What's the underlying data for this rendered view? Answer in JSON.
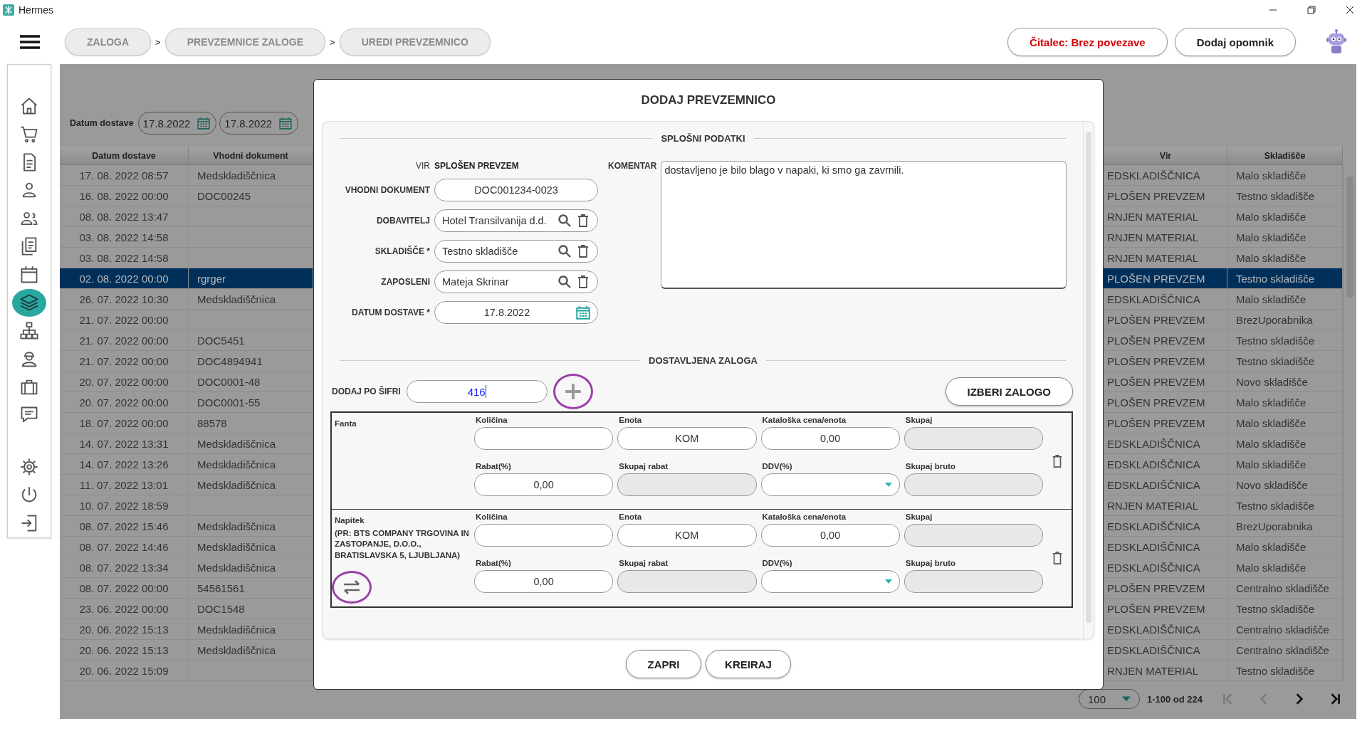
{
  "window": {
    "title": "Hermes"
  },
  "breadcrumbs": [
    {
      "label": "ZALOGA"
    },
    {
      "label": "PREVZEMNICE ZALOGE",
      "separator_before": ">"
    },
    {
      "label": "UREDI PREVZEMNICO",
      "separator_before": ">"
    }
  ],
  "header_buttons": [
    {
      "label": "Čitalec: Brez povezave",
      "kind": "warning"
    },
    {
      "label": "Dodaj opomnik",
      "kind": "normal"
    }
  ],
  "sidebar": {
    "items": [
      {
        "selected": false
      },
      {
        "selected": false
      },
      {
        "selected": false
      },
      {
        "selected": false
      },
      {
        "selected": false
      },
      {
        "selected": false
      },
      {
        "selected": false
      },
      {
        "selected": true
      },
      {
        "selected": false
      },
      {
        "selected": false
      },
      {
        "selected": false
      },
      {
        "selected": false
      }
    ],
    "bottom_items": [
      {
        "selected": false
      },
      {
        "selected": false
      },
      {
        "selected": false
      }
    ]
  },
  "filters": {
    "label": "Datum dostave",
    "date_from": "17.8.2022",
    "date_to": "17.8.2022"
  },
  "table": {
    "columns": [
      "Datum dostave",
      "Vhodni dokument",
      "Vir",
      "Skladišče"
    ],
    "rows": [
      {
        "date": "17. 08. 2022 08:57",
        "document": "Medskladiščnica",
        "source": "EDSKLADIŠČNICA",
        "warehouse": "Malo skladišče",
        "selected": false
      },
      {
        "date": "16. 08. 2022 00:00",
        "document": "DOC00245",
        "source": "PLOŠEN PREVZEM",
        "warehouse": "Testno skladišče",
        "selected": false
      },
      {
        "date": "08. 08. 2022 13:47",
        "source": "RNJEN MATERIAL",
        "warehouse": "Malo skladišče",
        "selected": false
      },
      {
        "date": "03. 08. 2022 14:58",
        "source": "RNJEN MATERIAL",
        "warehouse": "Malo skladišče",
        "selected": false
      },
      {
        "date": "03. 08. 2022 14:58",
        "source": "RNJEN MATERIAL",
        "warehouse": "Malo skladišče",
        "selected": false
      },
      {
        "date": "02. 08. 2022 00:00",
        "document": "rgrger",
        "source": "PLOŠEN PREVZEM",
        "warehouse": "Testno skladišče",
        "selected": true
      },
      {
        "date": "26. 07. 2022 10:30",
        "document": "Medskladiščnica",
        "source": "EDSKLADIŠČNICA",
        "warehouse": "Malo skladišče",
        "selected": false
      },
      {
        "date": "21. 07. 2022 00:00",
        "source": "PLOŠEN PREVZEM",
        "warehouse": "BrezUporabnika",
        "selected": false
      },
      {
        "date": "21. 07. 2022 00:00",
        "document": "DOC5451",
        "source": "PLOŠEN PREVZEM",
        "warehouse": "Testno skladišče",
        "selected": false
      },
      {
        "date": "21. 07. 2022 00:00",
        "document": "DOC4894941",
        "source": "PLOŠEN PREVZEM",
        "warehouse": "Testno skladišče",
        "selected": false
      },
      {
        "date": "20. 07. 2022 00:00",
        "document": "DOC0001-48",
        "source": "PLOŠEN PREVZEM",
        "warehouse": "Novo skladišče",
        "selected": false
      },
      {
        "date": "20. 07. 2022 00:00",
        "document": "DOC0001-55",
        "source": "PLOŠEN PREVZEM",
        "warehouse": "Malo skladišče",
        "selected": false
      },
      {
        "date": "18. 07. 2022 00:00",
        "document": "88578",
        "source": "PLOŠEN PREVZEM",
        "warehouse": "Malo skladišče",
        "selected": false
      },
      {
        "date": "14. 07. 2022 13:31",
        "document": "Medskladiščnica",
        "source": "EDSKLADIŠČNICA",
        "warehouse": "Malo skladišče",
        "selected": false
      },
      {
        "date": "14. 07. 2022 13:26",
        "document": "Medskladiščnica",
        "source": "EDSKLADIŠČNICA",
        "warehouse": "Malo skladišče",
        "selected": false
      },
      {
        "date": "11. 07. 2022 13:01",
        "document": "Medskladiščnica",
        "source": "EDSKLADIŠČNICA",
        "warehouse": "Novo skladišče",
        "selected": false
      },
      {
        "date": "10. 07. 2022 18:59",
        "source": "RNJEN MATERIAL",
        "warehouse": "Testno skladišče",
        "selected": false
      },
      {
        "date": "08. 07. 2022 15:46",
        "document": "Medskladiščnica",
        "source": "EDSKLADIŠČNICA",
        "warehouse": "BrezUporabnika",
        "selected": false
      },
      {
        "date": "08. 07. 2022 14:46",
        "document": "Medskladiščnica",
        "source": "EDSKLADIŠČNICA",
        "warehouse": "Malo skladišče",
        "selected": false
      },
      {
        "date": "08. 07. 2022 13:34",
        "document": "Medskladiščnica",
        "source": "EDSKLADIŠČNICA",
        "warehouse": "Malo skladišče",
        "selected": false
      },
      {
        "date": "08. 07. 2022 00:00",
        "document": "54561561",
        "source": "PLOŠEN PREVZEM",
        "warehouse": "Centralno skladišče",
        "selected": false
      },
      {
        "date": "23. 06. 2022 00:00",
        "document": "DOC1548",
        "source": "PLOŠEN PREVZEM",
        "warehouse": "Testno skladišče",
        "selected": false
      },
      {
        "date": "20. 06. 2022 15:13",
        "document": "Medskladiščnica",
        "source": "EDSKLADIŠČNICA",
        "warehouse": "Centralno skladišče",
        "selected": false
      },
      {
        "date": "20. 06. 2022 15:13",
        "document": "Medskladiščnica",
        "source": "EDSKLADIŠČNICA",
        "warehouse": "Centralno skladišče",
        "selected": false
      },
      {
        "date": "20. 06. 2022 15:09",
        "source": "RNJEN MATERIAL",
        "warehouse": "Testno skladišče",
        "selected": false
      }
    ]
  },
  "pagination": {
    "page_size": "100",
    "range": "1-100 od 224"
  },
  "dialog": {
    "title": "DODAJ PREVZEMNICO",
    "general_title": "SPLOŠNI PODATKI",
    "source_label": "VIR",
    "source_value": "SPLOŠEN PREVZEM",
    "fields": [
      {
        "label": "VHODNI DOKUMENT",
        "value": "DOC001234-0023",
        "kind": "text"
      },
      {
        "label": "DOBAVITELJ",
        "value": "Hotel Transilvanija d.d.",
        "kind": "lookup"
      },
      {
        "label": "SKLADIŠČE *",
        "value": "Testno skladišče",
        "kind": "lookup"
      },
      {
        "label": "ZAPOSLENI",
        "value": "Mateja Skrinar",
        "kind": "lookup"
      },
      {
        "label": "DATUM DOSTAVE *",
        "value": "17.8.2022",
        "kind": "date"
      }
    ],
    "comment_label": "KOMENTAR",
    "comment": "dostavljeno je bilo blago v napaki, ki smo ga zavrnili.",
    "stock_title": "DOSTAVLJENA ZALOGA",
    "add_by_code": {
      "label": "DODAJ PO ŠIFRI",
      "value": "416"
    },
    "choose_button": "IZBERI ZALOGO",
    "items": [
      {
        "name": "Fanta",
        "swappable": false,
        "fields": [
          {
            "label": "Količina",
            "kind": "input"
          },
          {
            "label": "Enota",
            "value": "KOM",
            "kind": "input"
          },
          {
            "label": "Kataloška cena/enota",
            "value": "0,00",
            "kind": "input"
          },
          {
            "label": "Skupaj",
            "kind": "readonly"
          },
          {
            "label": "Rabat(%)",
            "value": "0,00",
            "kind": "input"
          },
          {
            "label": "Skupaj rabat",
            "kind": "readonly"
          },
          {
            "label": "DDV(%)",
            "kind": "select"
          },
          {
            "label": "Skupaj bruto",
            "kind": "readonly"
          }
        ]
      },
      {
        "name": "Napitek",
        "note": "(PR: BTS COMPANY TRGOVINA IN ZASTOPANJE, D.O.O., BRATISLAVSKA 5, LJUBLJANA)",
        "swappable": true,
        "fields": [
          {
            "label": "Količina",
            "kind": "input"
          },
          {
            "label": "Enota",
            "value": "KOM",
            "kind": "input"
          },
          {
            "label": "Kataloška cena/enota",
            "value": "0,00",
            "kind": "input"
          },
          {
            "label": "Skupaj",
            "kind": "readonly"
          },
          {
            "label": "Rabat(%)",
            "value": "0,00",
            "kind": "input"
          },
          {
            "label": "Skupaj rabat",
            "kind": "readonly"
          },
          {
            "label": "DDV(%)",
            "kind": "select"
          },
          {
            "label": "Skupaj bruto",
            "kind": "readonly"
          }
        ]
      }
    ],
    "buttons": [
      "ZAPRI",
      "KREIRAJ"
    ]
  }
}
